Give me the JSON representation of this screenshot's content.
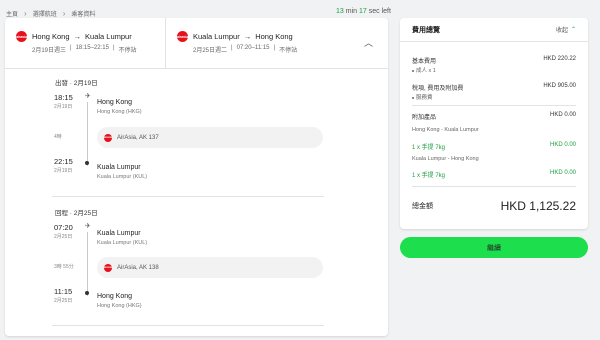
{
  "breadcrumb": [
    "主頁",
    "選擇航班",
    "乘客資料"
  ],
  "timer": {
    "min": "13",
    "min_label": "min",
    "sec": "17",
    "sec_label": "sec left"
  },
  "airline_logo_text": "airasia",
  "trip": {
    "out": {
      "from": "Hong Kong",
      "to": "Kuala Lumpur",
      "date": "2月19日週三",
      "time": "18:15–22:15",
      "stops": "不停站"
    },
    "ret": {
      "from": "Kuala Lumpur",
      "to": "Hong Kong",
      "date": "2月25日週二",
      "time": "07:20–11:15",
      "stops": "不停站"
    }
  },
  "outbound": {
    "label": "出發 · 2月19日",
    "dep_time": "18:15",
    "dep_date": "2月19日",
    "dep_city": "Hong Kong",
    "dep_ap": "Hong Kong (HKG)",
    "duration": "4時",
    "flight": "AirAsia, AK 137",
    "arr_time": "22:15",
    "arr_date": "2月19日",
    "arr_city": "Kuala Lumpur",
    "arr_ap": "Kuala Lumpur (KUL)"
  },
  "inbound": {
    "label": "回程 · 2月25日",
    "dep_time": "07:20",
    "dep_date": "2月25日",
    "dep_city": "Kuala Lumpur",
    "dep_ap": "Kuala Lumpur (KUL)",
    "duration": "3時 55分",
    "flight": "AirAsia, AK 138",
    "arr_time": "11:15",
    "arr_date": "2月25日",
    "arr_city": "Hong Kong",
    "arr_ap": "Hong Kong (HKG)"
  },
  "summary": {
    "title": "費用總覽",
    "collapse": "收起",
    "base_label": "基本費用",
    "base_value": "HKD 220.22",
    "base_sub": "成人 x 1",
    "tax_label": "稅項, 費用及附加費",
    "tax_value": "HKD 905.00",
    "tax_sub": "服務費",
    "addon_label": "附加產品",
    "addon_value": "HKD 0.00",
    "seg1": "Hong Kong - Kuala Lumpur",
    "seg1_item": "1 x 手提 7kg",
    "seg1_value": "HKD 0.00",
    "seg2": "Kuala Lumpur - Hong Kong",
    "seg2_item": "1 x 手提 7kg",
    "seg2_value": "HKD 0.00",
    "total_label": "總金額",
    "total_value": "HKD 1,125.22"
  },
  "cta": "繼續"
}
